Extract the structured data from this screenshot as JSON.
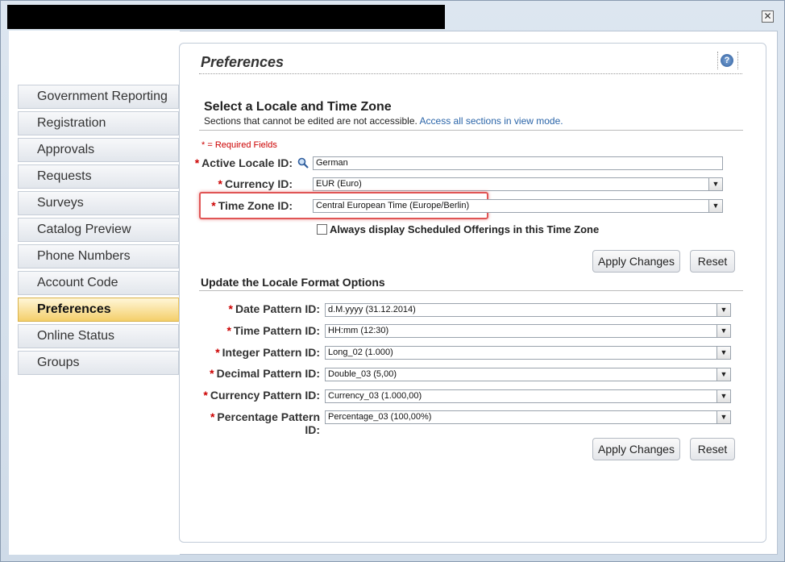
{
  "window": {
    "close_glyph": "✕"
  },
  "nav": {
    "items": [
      {
        "label": "Government Reporting"
      },
      {
        "label": "Registration"
      },
      {
        "label": "Approvals"
      },
      {
        "label": "Requests"
      },
      {
        "label": "Surveys"
      },
      {
        "label": "Catalog Preview"
      },
      {
        "label": "Phone Numbers"
      },
      {
        "label": "Account Code"
      },
      {
        "label": "Preferences"
      },
      {
        "label": "Online Status"
      },
      {
        "label": "Groups"
      }
    ]
  },
  "page": {
    "title": "Preferences",
    "help_glyph": "?"
  },
  "locale_section": {
    "title": "Select a Locale and Time Zone",
    "subtitle": "Sections that cannot be edited are not accessible.",
    "link": "Access all sections in view mode.",
    "required_note": "* = Required Fields",
    "active_locale_label": "Active Locale ID:",
    "active_locale_value": "German",
    "currency_label": "Currency ID:",
    "currency_value": "EUR (Euro)",
    "timezone_label": "Time Zone ID:",
    "timezone_value": "Central European Time (Europe/Berlin)",
    "always_display_label": "Always display Scheduled Offerings in this Time Zone",
    "apply_label": "Apply Changes",
    "reset_label": "Reset"
  },
  "format_section": {
    "title": "Update the Locale Format Options",
    "date_label": "Date Pattern ID:",
    "date_value": "d.M.yyyy (31.12.2014)",
    "time_label": "Time Pattern ID:",
    "time_value": "HH:mm (12:30)",
    "integer_label": "Integer Pattern ID:",
    "integer_value": "Long_02 (1.000)",
    "decimal_label": "Decimal Pattern ID:",
    "decimal_value": "Double_03 (5,00)",
    "currency_label": "Currency Pattern ID:",
    "currency_value": "Currency_03 (1.000,00)",
    "percentage_label": "Percentage Pattern ID:",
    "percentage_value": "Percentage_03 (100,00%)",
    "apply_label": "Apply Changes",
    "reset_label": "Reset"
  },
  "colors": {
    "required": "#cc0000",
    "active_nav": "#f4cf6a",
    "highlight": "#e05555",
    "link": "#2a64a8"
  }
}
